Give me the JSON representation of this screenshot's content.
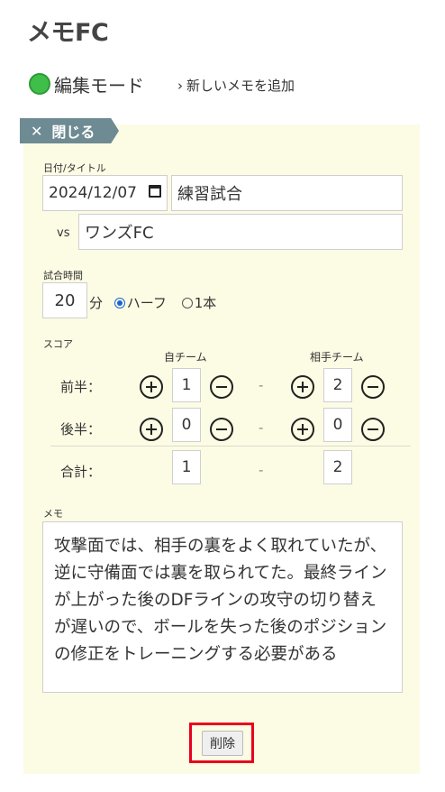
{
  "app": {
    "title": "メモFC"
  },
  "mode": {
    "label": "編集モード",
    "add_link": "新しいメモを追加"
  },
  "panel": {
    "close_label": "閉じる",
    "date_title_label": "日付/タイトル",
    "date_value": "2024/12/07",
    "title_value": "練習試合",
    "vs_label": "vs",
    "opponent_value": "ワンズFC",
    "match_time_label": "試合時間",
    "match_time_value": "20",
    "minutes_unit": "分",
    "options": {
      "half": "ハーフ",
      "full": "1本",
      "selected": "half"
    },
    "score_label": "スコア",
    "own_team_label": "自チーム",
    "opponent_team_label": "相手チーム",
    "rows": [
      {
        "label": "前半：",
        "own": "1",
        "opp": "2"
      },
      {
        "label": "後半：",
        "own": "0",
        "opp": "0"
      }
    ],
    "total": {
      "label": "合計：",
      "own": "1",
      "opp": "2"
    },
    "dash": "-",
    "memo_label": "メモ",
    "memo_text": "攻撃面では、相手の裏をよく取れていたが、逆に守備面では裏を取られてた。最終ラインが上がった後のDFラインの攻守の切り替えが遅いので、ボールを失った後のポジションの修正をトレーニングする必要がある",
    "delete_label": "削除"
  },
  "colors": {
    "panel_bg": "#fcfbe4",
    "tab_bg": "#6e8a93",
    "mode_dot": "#3fbf4a",
    "highlight": "#e8001c"
  }
}
